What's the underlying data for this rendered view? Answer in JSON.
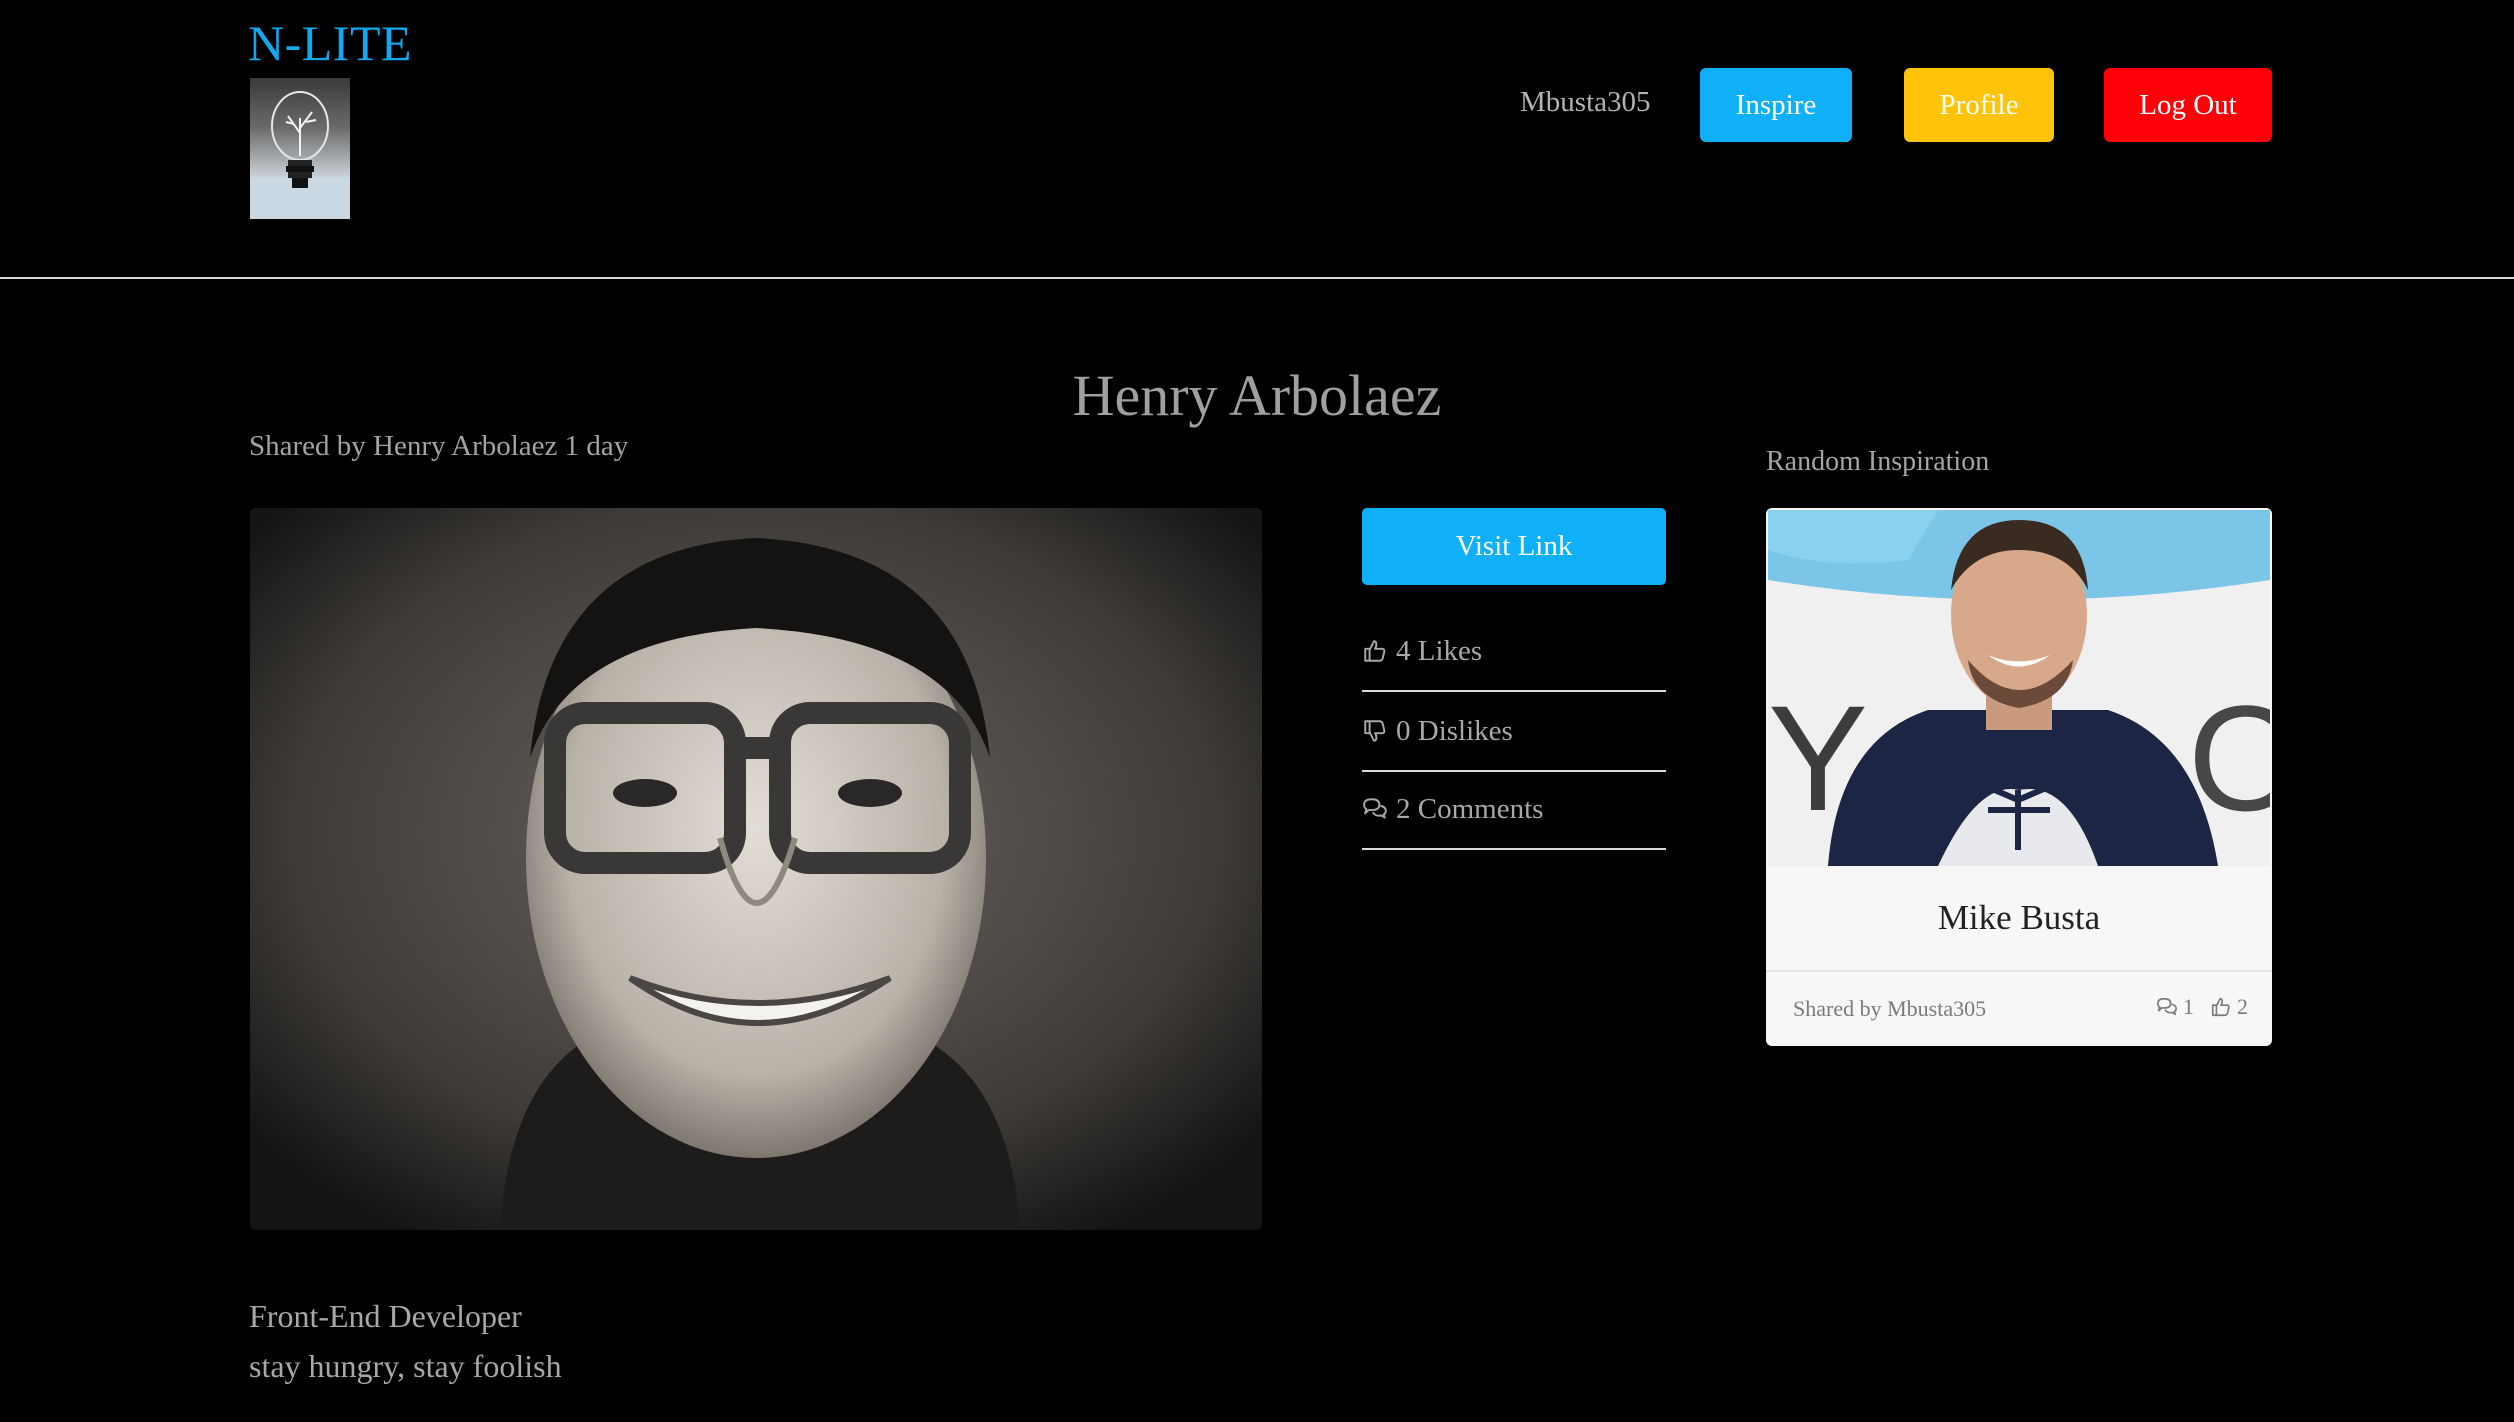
{
  "header": {
    "brand": "N-LITE",
    "username": "Mbusta305",
    "nav": {
      "inspire": "Inspire",
      "profile": "Profile",
      "logout": "Log Out"
    }
  },
  "post": {
    "title": "Henry Arbolaez",
    "meta": "Shared by Henry Arbolaez 1 day",
    "description_lines": [
      "Front-End Developer",
      "stay hungry, stay foolish"
    ],
    "actions": {
      "visit_link": "Visit Link",
      "likes": "4 Likes",
      "dislikes": "0 Dislikes",
      "comments": "2 Comments"
    }
  },
  "sidebar": {
    "heading": "Random Inspiration",
    "card": {
      "title": "Mike Busta",
      "shared_by": "Shared by Mbusta305",
      "comments": "1",
      "likes": "2"
    }
  },
  "icons": {
    "likes": "thumbs-up-icon",
    "dislikes": "thumbs-down-icon",
    "comments": "comments-icon"
  },
  "colors": {
    "brand": "#11a8f0",
    "inspire": "#0fb0f8",
    "profile": "#ffc30a",
    "logout": "#ff0008",
    "background": "#000000"
  }
}
